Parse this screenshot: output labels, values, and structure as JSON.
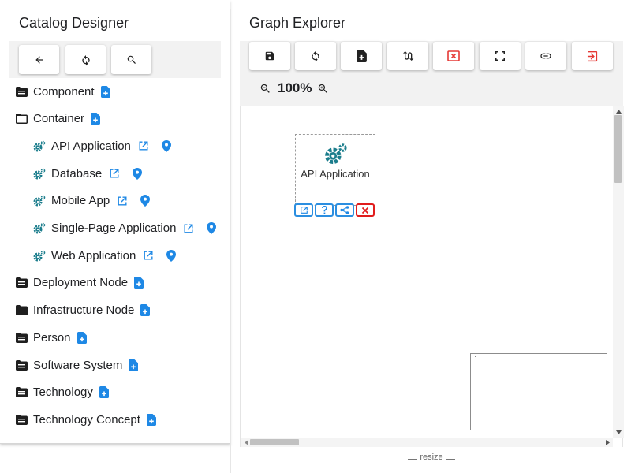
{
  "catalog": {
    "title": "Catalog Designer",
    "toolbar": [
      {
        "name": "back-button",
        "icon": "arrow-left-icon"
      },
      {
        "name": "refresh-button",
        "icon": "refresh-icon"
      },
      {
        "name": "search-button",
        "icon": "search-icon"
      }
    ],
    "tree": [
      {
        "label": "Component",
        "icon": "folder-filled-icon",
        "level": 0
      },
      {
        "label": "Container",
        "icon": "folder-open-icon",
        "level": 0
      },
      {
        "label": "API Application",
        "icon": "gears-icon",
        "level": 1
      },
      {
        "label": "Database",
        "icon": "gears-icon",
        "level": 1
      },
      {
        "label": "Mobile App",
        "icon": "gears-icon",
        "level": 1
      },
      {
        "label": "Single-Page Application",
        "icon": "gears-icon",
        "level": 1
      },
      {
        "label": "Web Application",
        "icon": "gears-icon",
        "level": 1
      },
      {
        "label": "Deployment Node",
        "icon": "folder-filled-icon",
        "level": 0
      },
      {
        "label": "Infrastructure Node",
        "icon": "folder-filled-icon",
        "level": 0
      },
      {
        "label": "Person",
        "icon": "folder-filled-icon",
        "level": 0
      },
      {
        "label": "Software System",
        "icon": "folder-filled-icon",
        "level": 0
      },
      {
        "label": "Technology",
        "icon": "folder-filled-icon",
        "level": 0
      },
      {
        "label": "Technology Concept",
        "icon": "folder-filled-icon",
        "level": 0
      }
    ]
  },
  "graph": {
    "title": "Graph Explorer",
    "toolbar": [
      {
        "name": "save-button",
        "icon": "save-icon"
      },
      {
        "name": "refresh-button",
        "icon": "refresh-icon"
      },
      {
        "name": "new-file-button",
        "icon": "file-plus-icon"
      },
      {
        "name": "layout-button",
        "icon": "swap-vertical-icon"
      },
      {
        "name": "clear-button",
        "icon": "close-box-icon"
      },
      {
        "name": "fullscreen-button",
        "icon": "fullscreen-icon"
      },
      {
        "name": "link-button",
        "icon": "link-icon"
      },
      {
        "name": "exit-button",
        "icon": "exit-icon"
      }
    ],
    "zoom": "100%",
    "node": {
      "label": "API Application",
      "icon": "gears-icon",
      "actions": [
        {
          "name": "open-node-button",
          "icon": "open-in-new-icon"
        },
        {
          "name": "help-node-button",
          "icon": "help-icon"
        },
        {
          "name": "share-node-button",
          "icon": "share-icon"
        },
        {
          "name": "delete-node-button",
          "icon": "close-icon"
        }
      ]
    },
    "resize_label": "resize"
  },
  "colors": {
    "accent": "#1e88e5",
    "teal": "#1b7d8c",
    "danger": "#e11d1d",
    "toolbar_bg": "#f2f2f2"
  }
}
